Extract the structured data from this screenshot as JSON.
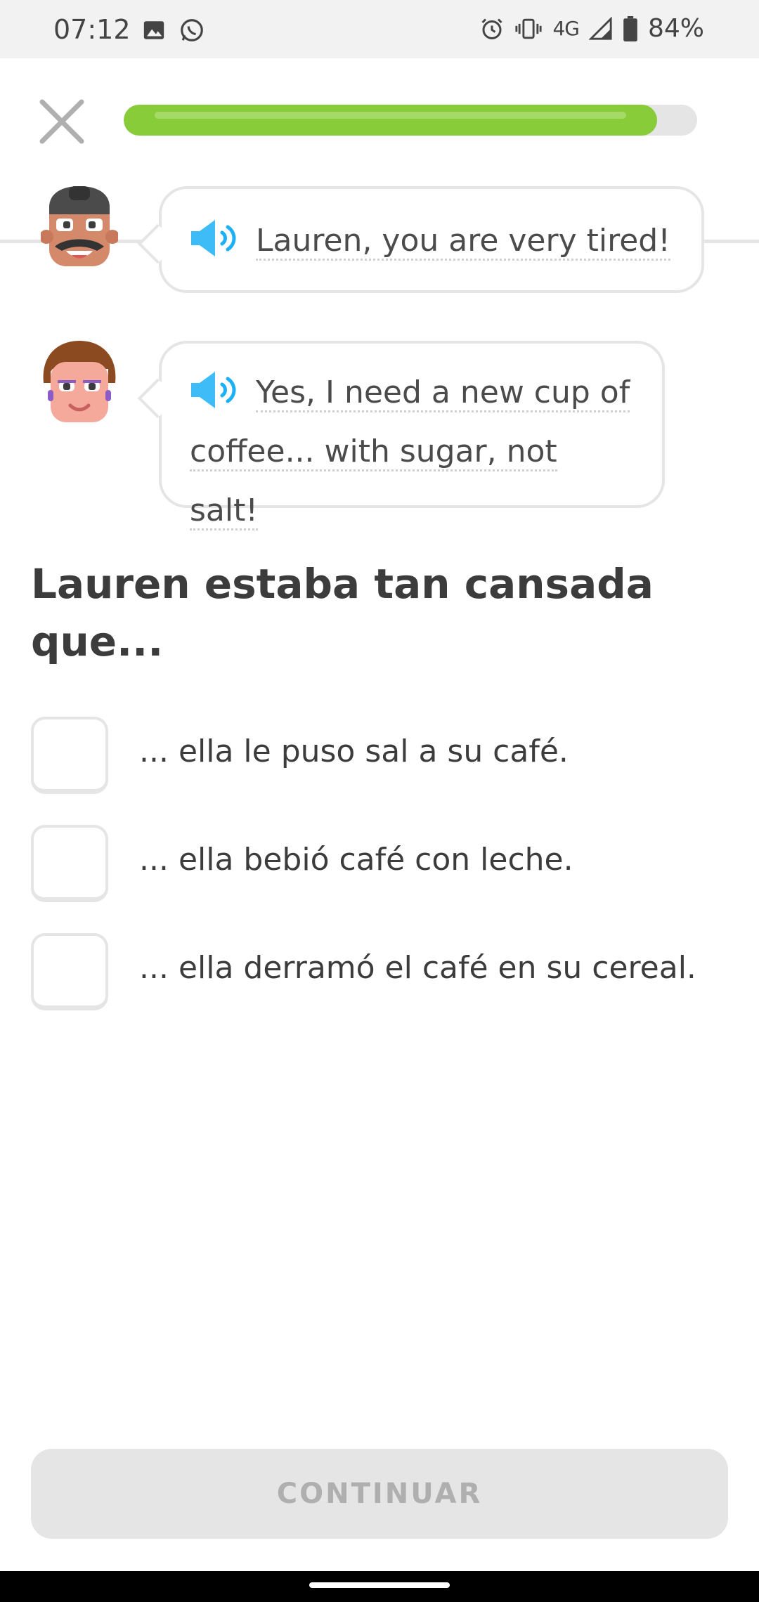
{
  "status_bar": {
    "time": "07:12",
    "network": "4G",
    "battery": "84%",
    "icons": [
      "image-icon",
      "whatsapp-icon",
      "alarm-icon",
      "vibrate-icon",
      "signal-icon",
      "battery-icon"
    ]
  },
  "header": {
    "close_icon": "close-icon",
    "progress": 0.93,
    "colors": {
      "progress_fill": "#89cc3a",
      "progress_track": "#e5e5e5"
    }
  },
  "dialogue": [
    {
      "speaker": "avatar-man",
      "text": "Lauren, you are very tired!"
    },
    {
      "speaker": "avatar-woman",
      "text_line1": "Yes, I need a new cup of",
      "text_line2": "coffee... with sugar, not salt!"
    }
  ],
  "question": {
    "line1": "Lauren estaba tan cansada",
    "line2": "que..."
  },
  "options": [
    "... ella le puso sal a su café.",
    "... ella bebió café con leche.",
    "... ella derramó el café en su cereal."
  ],
  "footer": {
    "continue_label": "CONTINUAR"
  }
}
